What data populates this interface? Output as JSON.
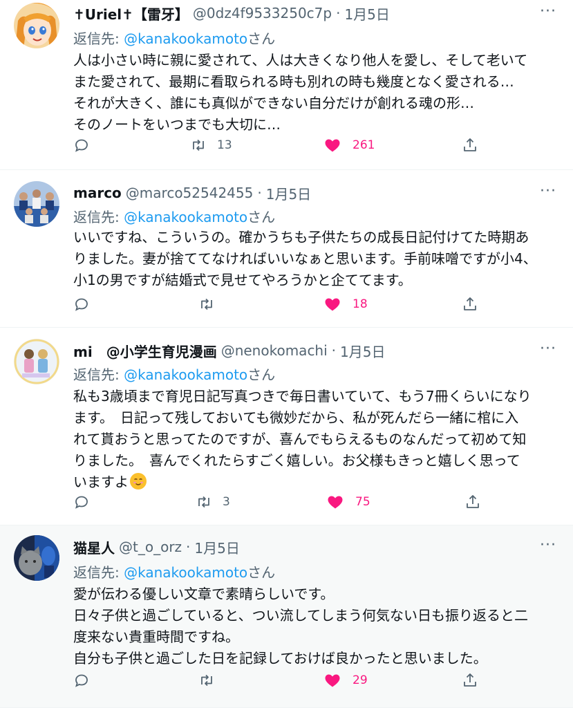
{
  "colors": {
    "accent": "#1d9bf0",
    "like": "#f91880",
    "muted": "#536471"
  },
  "tweets": [
    {
      "name": "✝Uriel✝【雷牙】",
      "handle": "@0dz4f9533250c7p",
      "sep": "·",
      "time": "1月5日",
      "more": "···",
      "reply_prefix": "返信先: ",
      "reply_mention": "@kanakookamoto",
      "reply_suffix": "さん",
      "lines": [
        "人は小さい時に親に愛されて、人は大きくなり他人を愛し、そして老いて",
        "また愛されて、最期に看取られる時も別れの時も幾度となく愛される…",
        "それが大きく、誰にも真似ができない自分だけが創れる魂の形…",
        "そのノートをいつまでも大切に…"
      ],
      "retweets": "13",
      "likes": "261",
      "avatar_icon": "anime-character-avatar"
    },
    {
      "name": "marco",
      "handle": "@marco52542455",
      "sep": "·",
      "time": "1月5日",
      "more": "···",
      "reply_prefix": "返信先: ",
      "reply_mention": "@kanakookamoto",
      "reply_suffix": "さん",
      "lines": [
        "いいですね、こういうの。確かうちも子供たちの成長日記付けてた時期あ",
        "りました。妻が捨ててなければいいなぁと思います。手前味噌ですが小4、",
        "小1の男ですが結婚式で見せてやろうかと企ててます。"
      ],
      "retweets": "",
      "likes": "18",
      "avatar_icon": "team-photo-avatar"
    },
    {
      "name": "mi　@小学生育児漫画",
      "handle": "@nenokomachi",
      "sep": "·",
      "time": "1月5日",
      "more": "···",
      "reply_prefix": "返信先: ",
      "reply_mention": "@kanakookamoto",
      "reply_suffix": "さん",
      "lines": [
        "私も3歳頃まで育児日記写真つきで毎日書いていて、もう7冊くらいになり",
        "ます。　日記って残しておいても微妙だから、私が死んだら一緒に棺に入",
        "れて貰おうと思ってたのですが、喜んでもらえるものなんだって初めて知",
        "りました。　喜んでくれたらすごく嬉しい。お父様もきっと嬉しく思って",
        "いますよ"
      ],
      "emoji_icon": "smiling-face-emoji-icon",
      "retweets": "3",
      "likes": "75",
      "avatar_icon": "illustration-avatar"
    },
    {
      "name": "猫星人",
      "handle": "@t_o_orz",
      "sep": "·",
      "time": "1月5日",
      "more": "···",
      "reply_prefix": "返信先: ",
      "reply_mention": "@kanakookamoto",
      "reply_suffix": "さん",
      "lines": [
        "愛が伝わる優しい文章で素晴らしいです。",
        "日々子供と過ごしていると、つい流してしまう何気ない日も振り返ると二",
        "度来ない貴重時間ですね。",
        "自分も子供と過ごした日を記録しておけば良かったと思いました。"
      ],
      "retweets": "",
      "likes": "29",
      "avatar_icon": "cat-photo-avatar"
    }
  ]
}
